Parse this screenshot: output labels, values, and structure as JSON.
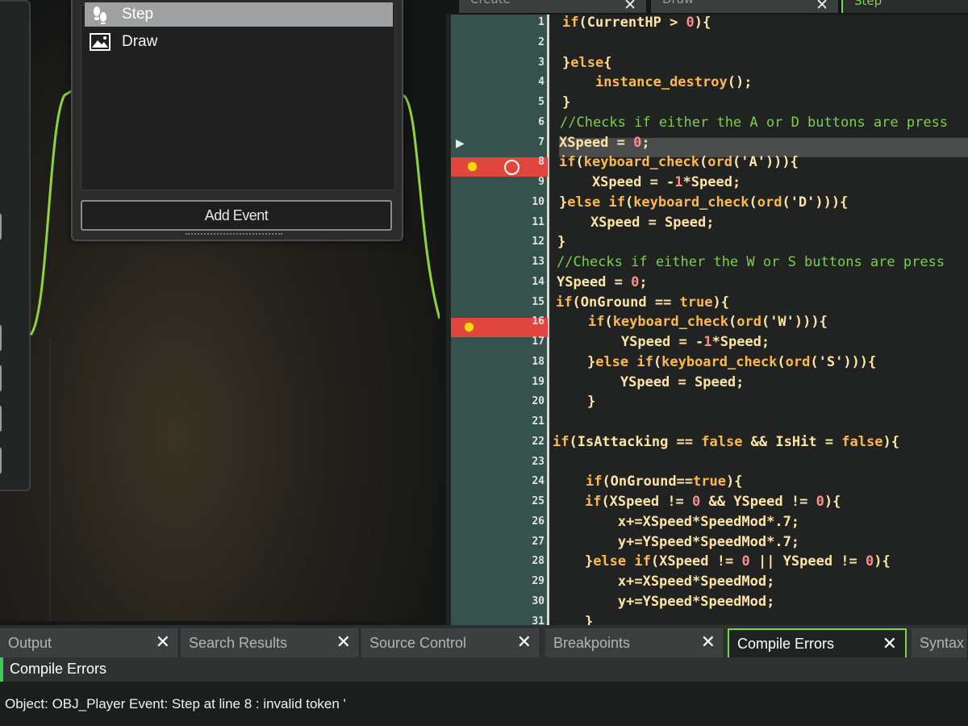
{
  "events_window": {
    "items": [
      {
        "label": "Step",
        "icon": "footprints-icon",
        "selected": true
      },
      {
        "label": "Draw",
        "icon": "picture-icon",
        "selected": false
      }
    ],
    "add_event_label": "Add Event"
  },
  "editor": {
    "tabs": [
      {
        "label": "Create",
        "active": false
      },
      {
        "label": "Draw",
        "active": false
      },
      {
        "label": "Step",
        "active": true
      }
    ],
    "current_line": 7,
    "breakpoints": [
      8,
      16
    ],
    "line_numbers": [
      "1",
      "2",
      "3",
      "4",
      "5",
      "6",
      "7",
      "8",
      "9",
      "10",
      "11",
      "12",
      "13",
      "14",
      "15",
      "16",
      "17",
      "18",
      "19",
      "20",
      "21",
      "22",
      "23",
      "24",
      "25",
      "26",
      "27",
      "28",
      "29",
      "30",
      "31"
    ],
    "code_lines": [
      "if(CurrentHP > 0){",
      "",
      "}else{",
      "    instance_destroy();",
      "}",
      "//Checks if either the A or D buttons are press",
      "XSpeed = 0;",
      "if(keyboard_check(ord('A'))){",
      "    XSpeed = -1*Speed;",
      "}else if(keyboard_check(ord('D'))){",
      "    XSpeed = Speed;",
      "}",
      "//Checks if either the W or S buttons are press",
      "YSpeed = 0;",
      "if(OnGround == true){",
      "    if(keyboard_check(ord('W'))){",
      "        YSpeed = -1*Speed;",
      "    }else if(keyboard_check(ord('S'))){",
      "        YSpeed = Speed;",
      "    }",
      "",
      "if(IsAttacking == false && IsHit = false){",
      "",
      "    if(OnGround==true){",
      "    if(XSpeed != 0 && YSpeed != 0){",
      "        x+=XSpeed*SpeedMod*.7;",
      "        y+=YSpeed*SpeedMod*.7;",
      "    }else if(XSpeed != 0 || YSpeed != 0){",
      "        x+=XSpeed*SpeedMod;",
      "        y+=YSpeed*SpeedMod;",
      "    }"
    ]
  },
  "bottom_panel": {
    "tabs": [
      {
        "label": "Output",
        "active": false
      },
      {
        "label": "Search Results",
        "active": false
      },
      {
        "label": "Source Control",
        "active": false
      },
      {
        "label": "Breakpoints",
        "active": false
      },
      {
        "label": "Compile Errors",
        "active": true
      },
      {
        "label": "Syntax",
        "active": false
      }
    ],
    "section_title": "Compile Errors",
    "error_message": "Object: OBJ_Player Event: Step at line 8 : invalid token '"
  },
  "colors": {
    "accent_green": "#79d64b",
    "breakpoint_red": "#e0463d",
    "breakpoint_yellow": "#ffd21e",
    "comment_green": "#7bd04a",
    "keyword_orange": "#ffb84c",
    "number_pink": "#ff8d8d"
  }
}
